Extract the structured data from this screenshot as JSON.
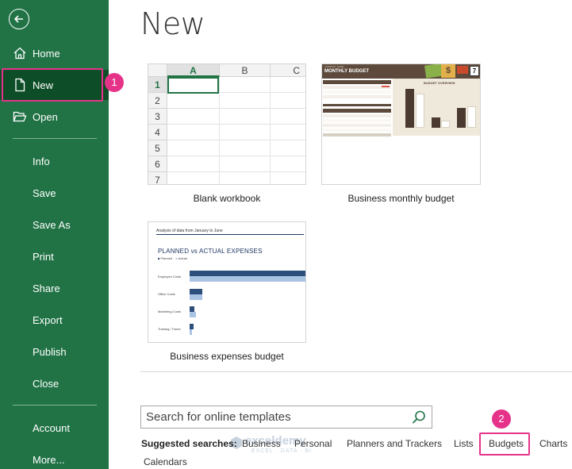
{
  "sidebar": {
    "nav": [
      {
        "key": "home",
        "label": "Home",
        "icon": "home-icon"
      },
      {
        "key": "new",
        "label": "New",
        "icon": "new-document-icon"
      },
      {
        "key": "open",
        "label": "Open",
        "icon": "folder-open-icon"
      }
    ],
    "items": [
      {
        "key": "info",
        "label": "Info"
      },
      {
        "key": "save",
        "label": "Save"
      },
      {
        "key": "save-as",
        "label": "Save As"
      },
      {
        "key": "print",
        "label": "Print"
      },
      {
        "key": "share",
        "label": "Share"
      },
      {
        "key": "export",
        "label": "Export"
      },
      {
        "key": "publish",
        "label": "Publish"
      },
      {
        "key": "close",
        "label": "Close"
      }
    ],
    "account": "Account",
    "more": "More...",
    "selected": "New"
  },
  "page": {
    "title": "New"
  },
  "steps": [
    "1",
    "2"
  ],
  "templates": [
    {
      "caption": "Blank workbook",
      "preview": {
        "columns": [
          "A",
          "B",
          "C"
        ],
        "rows": [
          "1",
          "2",
          "3",
          "4",
          "5",
          "6",
          "7"
        ]
      }
    },
    {
      "caption": "Business monthly budget",
      "preview": {
        "company": "COMPANY NAME",
        "title": "MONTHLY BUDGET",
        "chart_title": "BUDGET OVERVIEW",
        "calendar_day": "7"
      }
    },
    {
      "caption": "Business expenses budget",
      "preview": {
        "subtitle": "Analysis of data from January to June",
        "title": "PLANNED vs ACTUAL EXPENSES",
        "legend": [
          "Planned",
          "Actual"
        ],
        "categories": [
          "Employee Costs",
          "Office Costs",
          "Marketing Costs",
          "Training / Travel"
        ]
      }
    }
  ],
  "search": {
    "placeholder": "Search for online templates",
    "value": ""
  },
  "suggested": {
    "label": "Suggested searches:",
    "items": [
      "Business",
      "Personal",
      "Planners and Trackers",
      "Lists",
      "Budgets",
      "Charts",
      "Calendars"
    ]
  },
  "watermark": {
    "name": "exceldemy",
    "tagline": "EXCEL · DATA · BI"
  },
  "colors": {
    "sidebar": "#217346",
    "sidebar_selected": "#0d4e28",
    "highlight": "#e6338a",
    "budget_brown": "#5d4a3c",
    "expense_navy": "#1f3864"
  }
}
